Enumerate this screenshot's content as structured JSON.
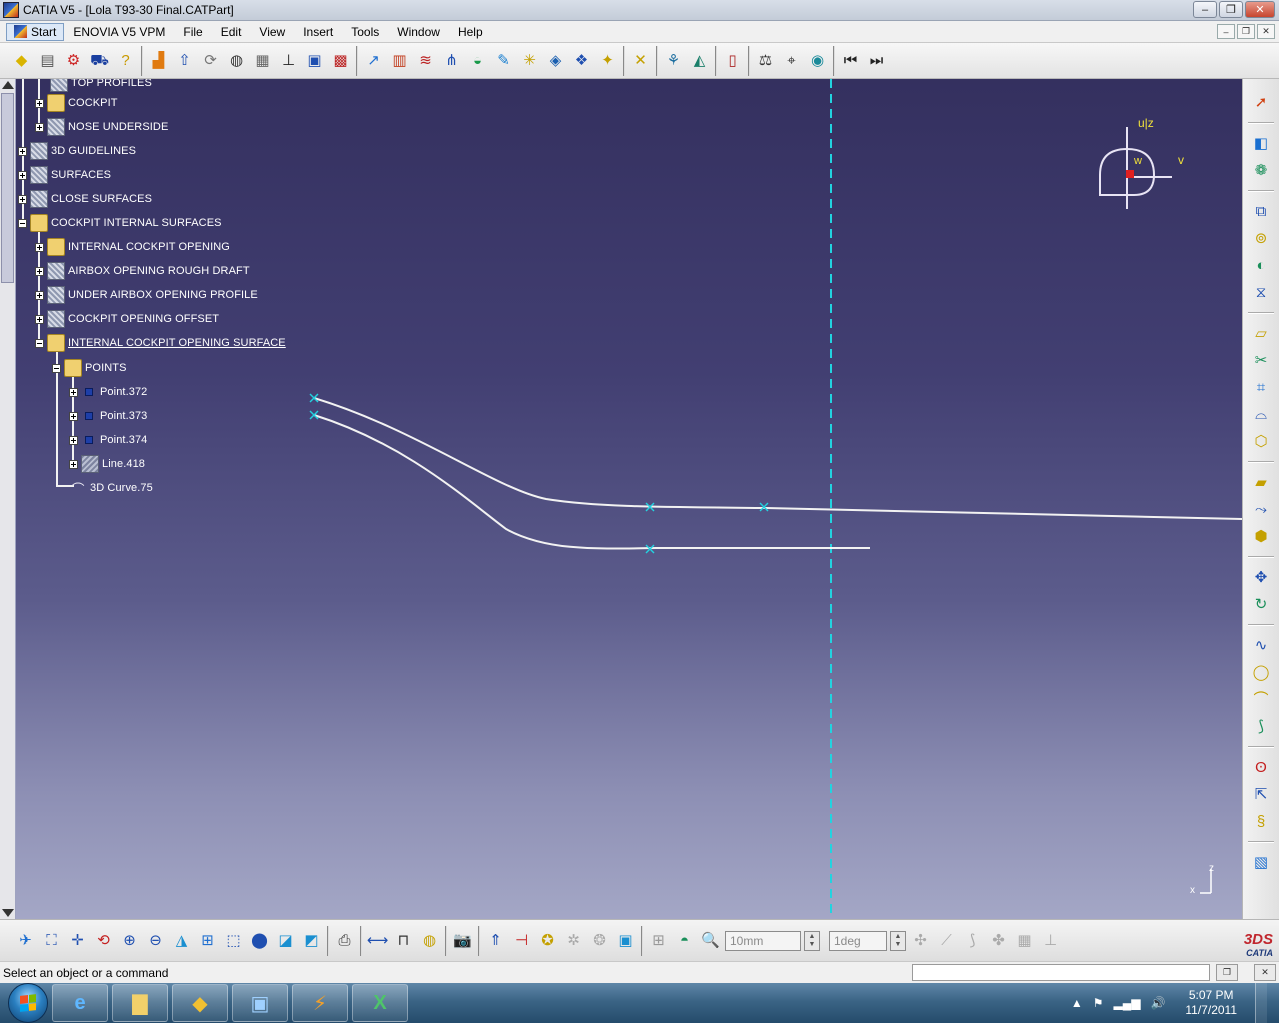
{
  "window": {
    "title": "CATIA V5 - [Lola T93-30 Final.CATPart]",
    "minimize": "–",
    "maximize": "❐",
    "close": "✕"
  },
  "menu": {
    "items": [
      "Start",
      "ENOVIA V5 VPM",
      "File",
      "Edit",
      "View",
      "Insert",
      "Tools",
      "Window",
      "Help"
    ],
    "mdi_min": "–",
    "mdi_restore": "❐",
    "mdi_close": "✕"
  },
  "tree": {
    "cut_top": "TOP PROFILES",
    "nodes": [
      {
        "label": "COCKPIT",
        "icon": "folder"
      },
      {
        "label": "NOSE UNDERSIDE",
        "icon": "geo"
      },
      {
        "label": "3D GUIDELINES",
        "icon": "geo"
      },
      {
        "label": "SURFACES",
        "icon": "geo"
      },
      {
        "label": "CLOSE SURFACES",
        "icon": "geo"
      },
      {
        "label": "COCKPIT INTERNAL SURFACES",
        "icon": "folder"
      },
      {
        "label": "INTERNAL COCKPIT OPENING",
        "icon": "folder"
      },
      {
        "label": "AIRBOX OPENING ROUGH DRAFT",
        "icon": "geo"
      },
      {
        "label": "UNDER AIRBOX OPENING PROFILE",
        "icon": "geo"
      },
      {
        "label": "COCKPIT OPENING OFFSET",
        "icon": "geo"
      },
      {
        "label": "INTERNAL COCKPIT OPENING SURFACE",
        "icon": "folder"
      },
      {
        "label": "POINTS",
        "icon": "folder"
      },
      {
        "label": "Point.372",
        "icon": "point"
      },
      {
        "label": "Point.373",
        "icon": "point"
      },
      {
        "label": "Point.374",
        "icon": "point"
      },
      {
        "label": "Line.418",
        "icon": "line"
      },
      {
        "label": "3D Curve.75",
        "icon": "curve"
      }
    ]
  },
  "compass": {
    "axis_top": "u|z",
    "axis_right": "v",
    "axis_center": "w"
  },
  "viewport_axis": {
    "z": "z",
    "x": "x"
  },
  "toolbar_bottom": {
    "grid_value": "10mm",
    "angle_value": "1deg"
  },
  "catia_logo": {
    "mark": "3DS",
    "name": "CATIA"
  },
  "status": {
    "message": "Select an object or a command"
  },
  "taskbar": {
    "time": "5:07 PM",
    "date": "11/7/2011"
  },
  "colors": {
    "viewport_top": "#34305f",
    "viewport_bottom": "#a4a7c6",
    "axis_line": "#22d3e0",
    "curve": "#ffffff",
    "point_mark": "#22d3e0"
  }
}
